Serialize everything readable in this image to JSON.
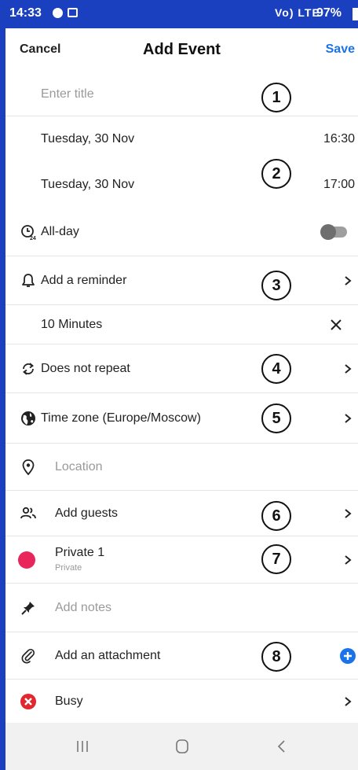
{
  "status": {
    "time": "14:33",
    "signal": "Vo) LTE",
    "battery": "97%"
  },
  "header": {
    "cancel": "Cancel",
    "title": "Add Event",
    "save": "Save"
  },
  "form": {
    "title_placeholder": "Enter title",
    "start_date": "Tuesday, 30 Nov",
    "start_time": "16:30",
    "end_date": "Tuesday, 30 Nov",
    "end_time": "17:00",
    "all_day": {
      "label": "All-day",
      "enabled": false
    },
    "reminder": {
      "label": "Add a reminder",
      "value": "10 Minutes"
    },
    "repeat": "Does not repeat",
    "timezone": "Time zone (Europe/Moscow)",
    "location_placeholder": "Location",
    "guests": "Add guests",
    "calendar": {
      "name": "Private 1",
      "type": "Private",
      "color": "#e8265c"
    },
    "notes_placeholder": "Add notes",
    "attachment": "Add an attachment",
    "availability": "Busy"
  },
  "badges": [
    "1",
    "2",
    "3",
    "4",
    "5",
    "6",
    "7",
    "8"
  ],
  "colors": {
    "accent": "#1a73e8",
    "status_bar": "#1a3fbf",
    "busy": "#e0282e"
  }
}
